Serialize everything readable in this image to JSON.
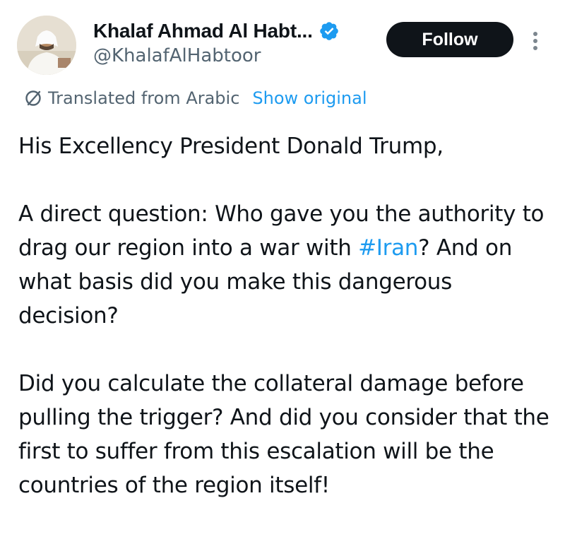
{
  "author": {
    "display_name": "Khalaf Ahmad Al Habt...",
    "handle": "@KhalafAlHabtoor",
    "verified_icon": "verified-badge-icon",
    "avatar_icon": "avatar"
  },
  "actions": {
    "follow_label": "Follow",
    "more_icon": "more-vertical-icon"
  },
  "translation": {
    "icon": "translate-icon",
    "label": "Translated from Arabic",
    "show_original_label": "Show original"
  },
  "tweet": {
    "line_greeting": "His Excellency President Donald Trump,",
    "para2_before_hashtag": "A direct question: Who gave you the authority to drag our region into a war with ",
    "hashtag": "#Iran",
    "para2_after_hashtag": "? And on what basis did you make this dangerous decision?",
    "para3": "Did you calculate the collateral damage before pulling the trigger? And did you consider that the first to suffer from this escalation will be the countries of the region itself!"
  },
  "colors": {
    "text": "#0f1419",
    "secondary": "#536471",
    "link": "#1d9bf0",
    "button_bg": "#0f1419",
    "button_text": "#ffffff"
  }
}
